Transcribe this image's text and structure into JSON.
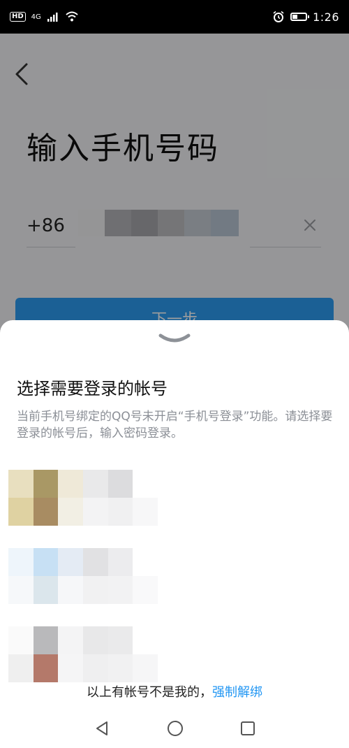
{
  "status_bar": {
    "hd": "HD",
    "network": "4G",
    "time": "1:26"
  },
  "page": {
    "title": "输入手机号码",
    "country_code": "+86",
    "next_button_label": "下一步"
  },
  "sheet": {
    "title": "选择需要登录的帐号",
    "description": "当前手机号绑定的QQ号未开启“手机号登录”功能。请选择要登录的帐号后，输入密码登录。",
    "unbind_prefix": "以上有帐号不是我的，",
    "unbind_link": "强制解绑"
  },
  "icons": {
    "back": "back-icon",
    "clear": "clear-icon",
    "handle": "chevron-down-icon",
    "nav_back": "triangle-back-icon",
    "nav_home": "circle-home-icon",
    "nav_recents": "square-recents-icon"
  },
  "colors": {
    "accent": "#2196f3",
    "button": "#2d9bf0",
    "overlay": "rgba(0,0,0,0.38)"
  }
}
